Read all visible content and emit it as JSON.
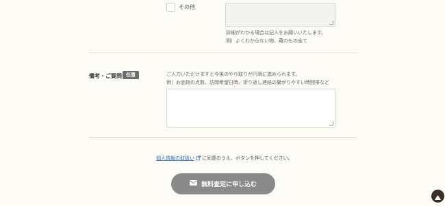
{
  "other_option": {
    "label": "その他",
    "help_line1": "詳細がわかる場合は記入をお願いいたします。",
    "help_line2": "例）よくわからない物、蔵のもの全て"
  },
  "remarks": {
    "label": "備考・ご質問",
    "badge": "任意",
    "help_line1": "ご入力いただけますと今後のやり取りが円滑に進められます。",
    "help_line2": "例）お品物の点数、訪問希望日時、折り返し連絡の繋がりやすい時間帯など"
  },
  "consent": {
    "link_text": "個人情報の取扱い",
    "suffix": "に同意のうえ、ボタンを押してください。"
  },
  "submit": {
    "label": "無料査定に申し込む"
  },
  "colors": {
    "background": "#fcfbf6",
    "button": "#8a8a8a",
    "badge": "#6b6b6b",
    "link": "#3a6fb0",
    "to_top": "#3b2e24"
  },
  "icons": {
    "external": "external-link-icon",
    "mail": "mail-icon",
    "to_top": "arrow-up-icon"
  }
}
